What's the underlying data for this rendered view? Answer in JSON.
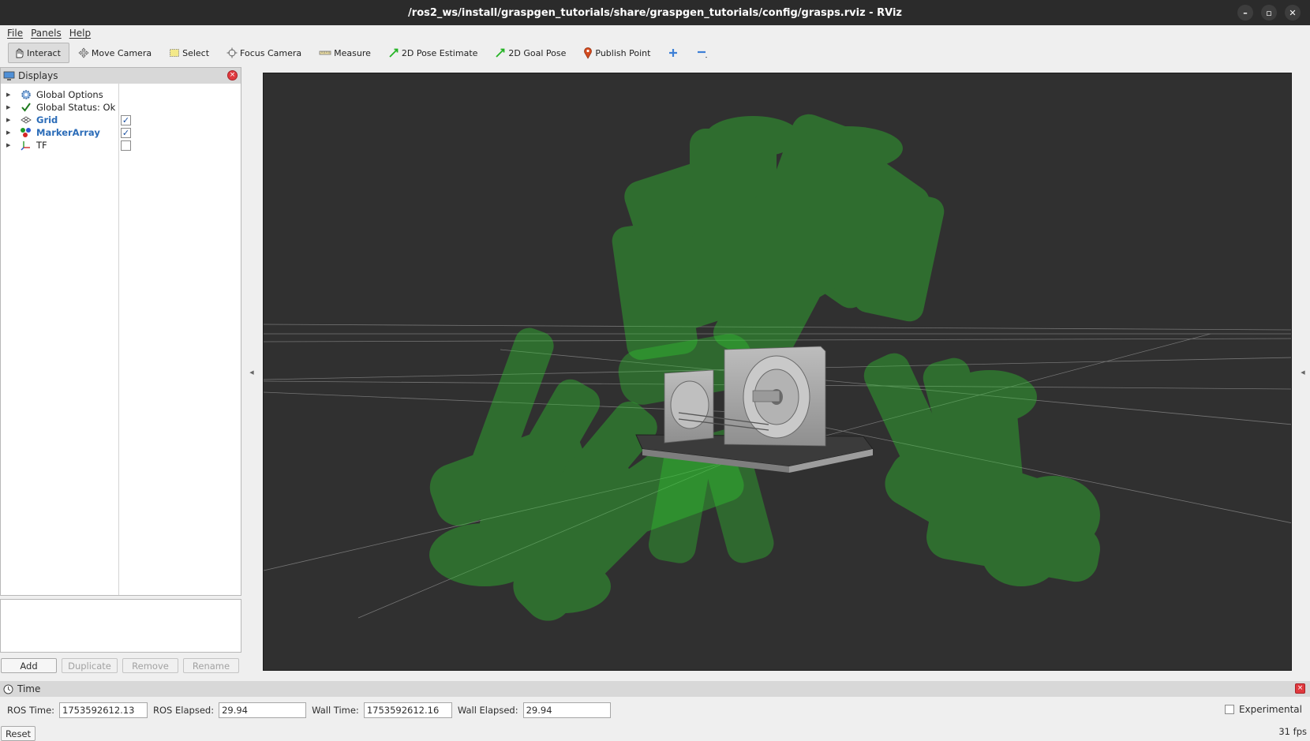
{
  "window": {
    "title": "/ros2_ws/install/graspgen_tutorials/share/graspgen_tutorials/config/grasps.rviz - RViz",
    "controls": [
      "–",
      "▫",
      "✕"
    ]
  },
  "menu": [
    "File",
    "Panels",
    "Help"
  ],
  "toolbar": [
    {
      "label": "Interact",
      "icon": "hand-pointer-icon",
      "active": true
    },
    {
      "label": "Move Camera",
      "icon": "move-camera-icon"
    },
    {
      "label": "Select",
      "icon": "select-box-icon"
    },
    {
      "label": "Focus Camera",
      "icon": "focus-camera-icon"
    },
    {
      "label": "Measure",
      "icon": "ruler-icon"
    },
    {
      "label": "2D Pose Estimate",
      "icon": "green-arrow-icon"
    },
    {
      "label": "2D Goal Pose",
      "icon": "green-arrow-icon"
    },
    {
      "label": "Publish Point",
      "icon": "map-pin-icon"
    },
    {
      "label": "",
      "icon": "add-tool-icon"
    },
    {
      "label": "",
      "icon": "remove-tool-icon"
    }
  ],
  "displays_panel": {
    "title": "Displays",
    "items": [
      {
        "label": "Global Options",
        "icon": "gear-icon",
        "checkbox": null
      },
      {
        "label": "Global Status: Ok",
        "icon": "checkmark-icon",
        "checkbox": null
      },
      {
        "label": "Grid",
        "icon": "grid-icon",
        "checkbox": true,
        "highlight": true
      },
      {
        "label": "MarkerArray",
        "icon": "markers-icon",
        "checkbox": true,
        "highlight": true
      },
      {
        "label": "TF",
        "icon": "tf-axes-icon",
        "checkbox": false
      }
    ],
    "buttons": {
      "add": "Add",
      "duplicate": "Duplicate",
      "remove": "Remove",
      "rename": "Rename"
    }
  },
  "time_panel": {
    "title": "Time",
    "ros_time_label": "ROS Time:",
    "ros_time": "1753592612.13",
    "ros_elapsed_label": "ROS Elapsed:",
    "ros_elapsed": "29.94",
    "wall_time_label": "Wall Time:",
    "wall_time": "1753592612.16",
    "wall_elapsed_label": "Wall Elapsed:",
    "wall_elapsed": "29.94",
    "experimental_label": "Experimental",
    "experimental_checked": false,
    "reset_label": "Reset",
    "fps": "31 fps"
  },
  "colors": {
    "viewport_bg": "#303030",
    "gripper_green": "#2fd02f",
    "object_gray": "#a9a9a9",
    "link_blue": "#2b6cb8",
    "close_red": "#e0393e"
  }
}
